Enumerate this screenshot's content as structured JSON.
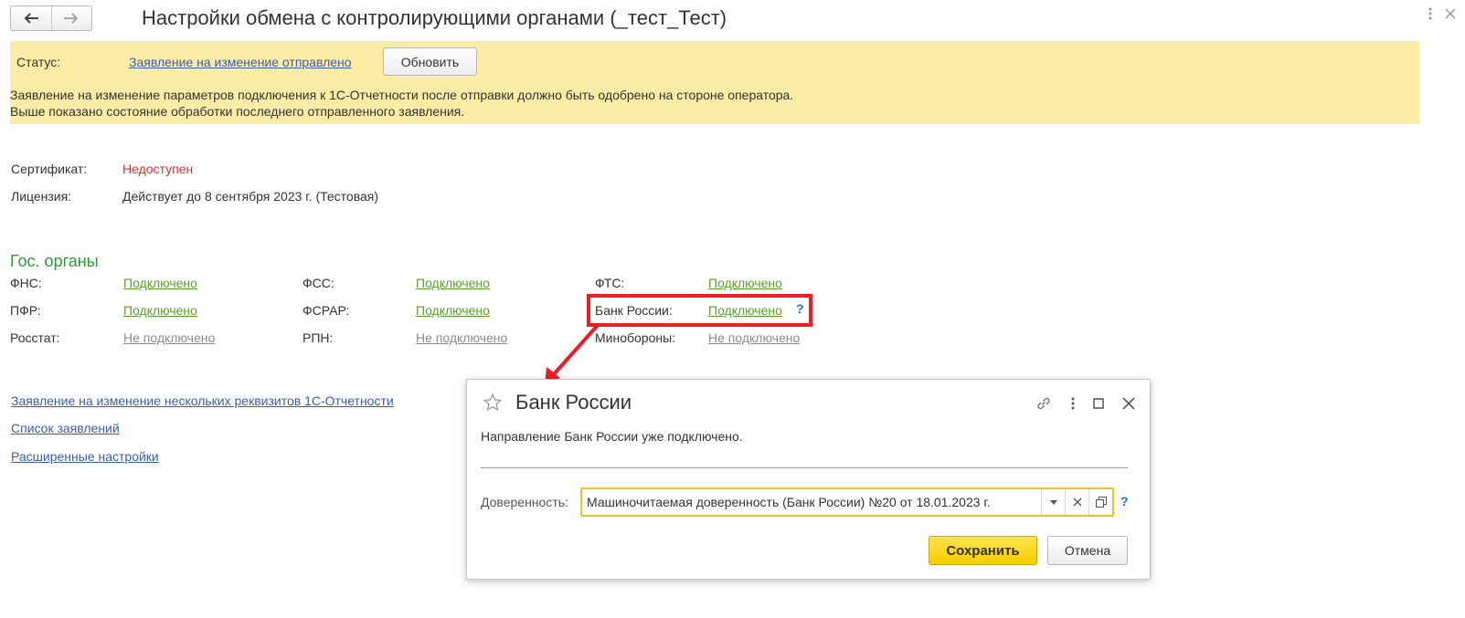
{
  "header": {
    "title": "Настройки обмена с контролирующими органами (_тест_Тест)",
    "back_icon": "arrow-left-icon",
    "forward_icon": "arrow-right-icon",
    "more_icon": "more-vertical-icon",
    "close_icon": "close-icon"
  },
  "status": {
    "label": "Статус:",
    "link": "Заявление на изменение отправлено",
    "refresh_label": "Обновить",
    "message_line1": "Заявление на изменение параметров подключения к 1С-Отчетности после отправки должно быть одобрено на стороне оператора.",
    "message_line2": "Выше показано состояние обработки последнего отправленного заявления.",
    "background": "#fbeca5"
  },
  "info": {
    "certificate_label": "Сертификат:",
    "certificate_value": "Недоступен",
    "license_label": "Лицензия:",
    "license_value": "Действует до 8 сентября 2023 г. (Тестовая)"
  },
  "gov": {
    "title": "Гос. органы",
    "items": [
      {
        "label": "ФНС:",
        "status": "Подключено",
        "connected": true
      },
      {
        "label": "ФСС:",
        "status": "Подключено",
        "connected": true
      },
      {
        "label": "ФТС:",
        "status": "Подключено",
        "connected": true
      },
      {
        "label": "ПФР:",
        "status": "Подключено",
        "connected": true
      },
      {
        "label": "ФСРАР:",
        "status": "Подключено",
        "connected": true
      },
      {
        "label": "Банк России:",
        "status": "Подключено",
        "connected": true
      },
      {
        "label": "Росстат:",
        "status": "Не подключено",
        "connected": false
      },
      {
        "label": "РПН:",
        "status": "Не подключено",
        "connected": false
      },
      {
        "label": "Минобороны:",
        "status": "Не подключено",
        "connected": false
      }
    ],
    "help": "?"
  },
  "links": {
    "change_details": "Заявление на изменение нескольких реквизитов 1С-Отчетности",
    "applications_list": "Список заявлений",
    "advanced_settings": "Расширенные настройки"
  },
  "dialog": {
    "title": "Банк России",
    "message": "Направление Банк России уже подключено.",
    "field_label": "Доверенность:",
    "field_value": "Машиночитаемая доверенность (Банк России) №20 от 18.01.2023 г.",
    "help": "?",
    "save_label": "Сохранить",
    "cancel_label": "Отмена",
    "icons": [
      "star-icon",
      "link-icon",
      "more-vertical-icon",
      "maximize-icon",
      "close-icon"
    ]
  },
  "colors": {
    "green": "#5a9f2e",
    "gray": "#8a8a8a",
    "link": "#3c5ea8",
    "section": "#2f9a3a",
    "highlight": "#ee1c25",
    "accent": "#f5cd00"
  }
}
